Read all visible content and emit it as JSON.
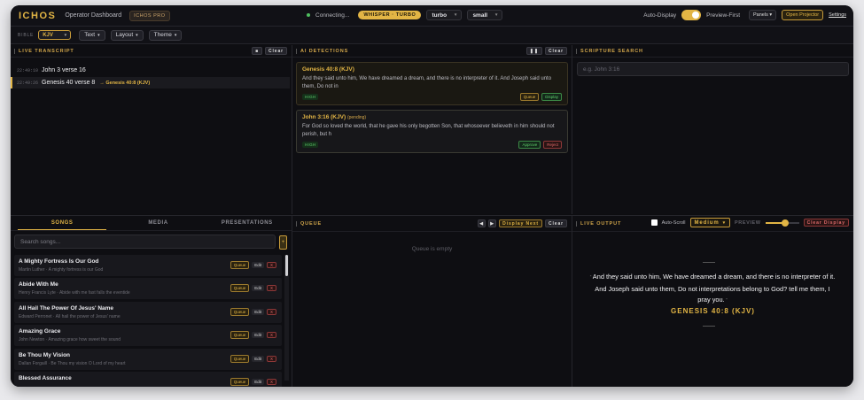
{
  "app": {
    "logo": "ICHOS",
    "subtitle": "Operator Dashboard",
    "edition": "ICHOS PRO"
  },
  "status": {
    "connection": "Connecting...",
    "engine_badge": "WHISPER · TURBO",
    "model": "turbo",
    "size": "small"
  },
  "topright": {
    "auto_display": "Auto-Display",
    "preview_first": "Preview-First",
    "panels": "Panels",
    "open_projector": "Open Projector",
    "settings": "Settings"
  },
  "toolbar": {
    "bible_label": "BIBLE",
    "bible_version": "KJV",
    "text": "Text",
    "layout": "Layout",
    "theme": "Theme"
  },
  "transcript": {
    "title": "LIVE TRANSCRIPT",
    "clear": "Clear",
    "lines": [
      {
        "time": "22:49:10",
        "text": "John 3 verse 16",
        "ref": ""
      },
      {
        "time": "22:49:26",
        "text": "Genesis 40 verse 8",
        "ref": "→ Genesis 40:8 (KJV)"
      }
    ]
  },
  "detections": {
    "title": "AI DETECTIONS",
    "clear": "Clear",
    "items": [
      {
        "ref": "Genesis 40:8 (KJV)",
        "pending": "",
        "text": "And they said unto him, We have dreamed a dream, and there is no interpreter of it. And Joseph said unto them, Do not in",
        "confidence": "HIGH",
        "a1": "Queue",
        "a2": "Display"
      },
      {
        "ref": "John 3:16 (KJV)",
        "pending": "(pending)",
        "text": "For God so loved the world, that he gave his only begotten Son, that whosoever believeth in him should not perish, but h",
        "confidence": "HIGH",
        "a1": "Approve",
        "a2": "Reject"
      }
    ]
  },
  "scripture": {
    "title": "SCRIPTURE SEARCH",
    "placeholder": "e.g. John 3:16"
  },
  "library": {
    "tabs": [
      "SONGS",
      "MEDIA",
      "PRESENTATIONS"
    ],
    "search_placeholder": "Search songs...",
    "queue": "Queue",
    "edit": "Edit",
    "delete": "X",
    "songs": [
      {
        "title": "A Mighty Fortress Is Our God",
        "sub": "Martin Luther · A mighty fortress is our God"
      },
      {
        "title": "Abide With Me",
        "sub": "Henry Francis Lyte · Abide with me fast falls the eventide"
      },
      {
        "title": "All Hail The Power Of Jesus' Name",
        "sub": "Edward Perronet · All hail the power of Jesus' name"
      },
      {
        "title": "Amazing Grace",
        "sub": "John Newton · Amazing grace how sweet the sound"
      },
      {
        "title": "Be Thou My Vision",
        "sub": "Dallan Forgaill · Be Thou my vision O Lord of my heart"
      },
      {
        "title": "Blessed Assurance",
        "sub": ""
      }
    ]
  },
  "queue": {
    "title": "QUEUE",
    "display_next": "Display Next",
    "clear": "Clear",
    "empty": "Queue is empty"
  },
  "output": {
    "title": "LIVE OUTPUT",
    "auto_scroll": "Auto-Scroll",
    "size": "Medium",
    "preview": "PREVIEW",
    "clear_display": "Clear Display",
    "preview_level": 0.6,
    "verse": "And they said unto him, We have dreamed a dream, and there is no interpreter of it. And Joseph said unto them, Do not interpretations belong to God? tell me them, I pray you.",
    "reference": "GENESIS 40:8 (KJV)"
  },
  "colors": {
    "accent": "#e2b545",
    "success": "#5fcf6b",
    "danger": "#e06b6b",
    "background": "#0d0d10"
  }
}
